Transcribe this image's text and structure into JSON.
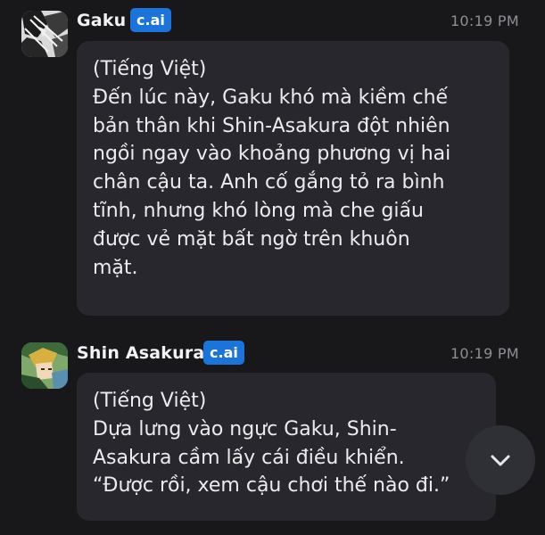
{
  "messages": [
    {
      "author": "Gaku",
      "badge": "c.ai",
      "time": "10:19 PM",
      "text": "(Tiếng Việt)\nĐến lúc này, Gaku khó mà kiềm chế\nbản thân khi Shin-Asakura đột nhiên\nngồi ngay vào khoảng phương vị hai\nchân cậu ta. Anh cố gắng tỏ ra bình\ntĩnh, nhưng khó lòng mà che giấu\nđược vẻ mặt bất ngờ trên khuôn\nmặt."
    },
    {
      "author": "Shin Asakura",
      "badge": "c.ai",
      "time": "10:19 PM",
      "text": "(Tiếng Việt)\nDựa lưng vào ngực Gaku, Shin-\nAsakura cầm lấy cái điều khiển.\n“Được rồi, xem cậu chơi thế nào đi.”"
    }
  ],
  "scroll_button": {
    "icon": "chevron-down-icon"
  },
  "colors": {
    "background": "#18181b",
    "bubble": "#27272d",
    "badge": "#1b74d9",
    "timestamp": "#8e8e96"
  }
}
